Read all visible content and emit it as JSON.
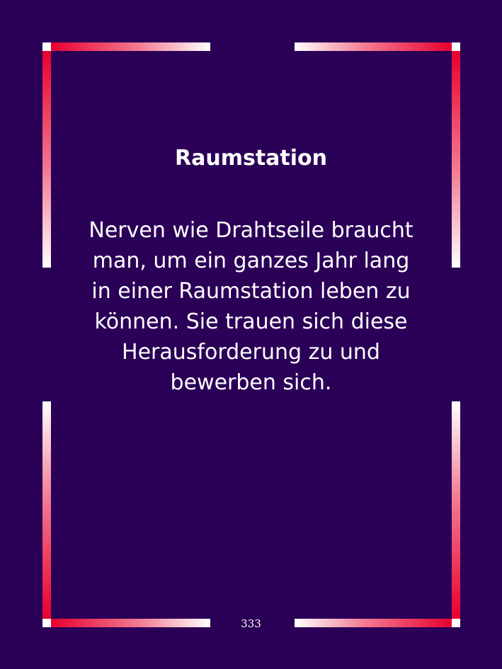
{
  "card": {
    "title": "Raumstation",
    "body_lines": [
      "Nerven wie Drahtseile braucht",
      "man, um ein ganzes Jahr lang",
      "in einer Raumstation leben zu",
      "können. Sie trauen sich diese",
      "Herausforderung zu und",
      "bewerben sich."
    ],
    "page_number": "333"
  },
  "colors": {
    "background": "#2b0057",
    "frame_red": "#e8002e",
    "frame_white": "#ffffff",
    "text": "#ffffff"
  }
}
